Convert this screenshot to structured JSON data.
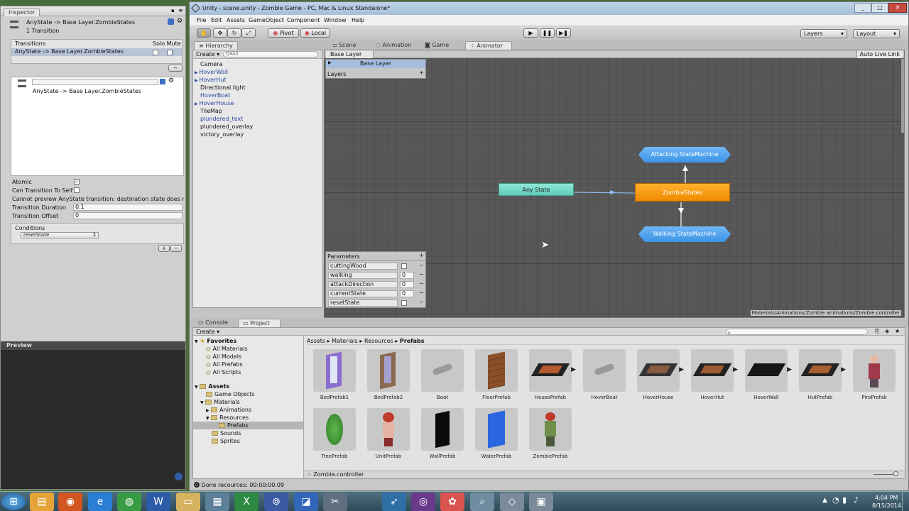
{
  "inspector": {
    "tab": "Inspector",
    "title": "AnyState -> Base Layer.ZombieStates",
    "subtitle": "1 Transition",
    "transitions_header": "Transitions",
    "solo_mute": "Solo Mute",
    "transition_row": "AnyState -> Base Layer.ZombieStates",
    "detail_name": "AnyState -> Base Layer.ZombieStates",
    "atomic": "Atomic",
    "can_self": "Can Transition To Self",
    "cannot_preview": "Cannot preview AnyState transition:  destination state does no",
    "duration_label": "Transition Duration",
    "duration_value": "0.1",
    "offset_label": "Transition Offset",
    "offset_value": "0",
    "conditions": "Conditions",
    "condition": "resetState",
    "preview": "Preview"
  },
  "window": {
    "title": "Unity - scene.unity - Zombie Game - PC, Mac & Linux Standalone*"
  },
  "menu": [
    "File",
    "Edit",
    "Assets",
    "GameObject",
    "Component",
    "Window",
    "Help"
  ],
  "toolbar": {
    "pivot": "Pivot",
    "local": "Local",
    "layers": "Layers",
    "layout": "Layout"
  },
  "tabs": {
    "hierarchy": "Hierarchy",
    "scene": "Scene",
    "animation": "Animation",
    "game": "Game",
    "animator": "Animator",
    "console": "Console",
    "project": "Project"
  },
  "hierarchy": {
    "create": "Create",
    "search": "Q▾All",
    "items": [
      "Camera",
      "HoverWall",
      "HoverHut",
      "Directional light",
      "HoverBoat",
      "HoverHouse",
      "TileMap",
      "plundered_text",
      "plundered_overlay",
      "victory_overlay"
    ]
  },
  "animator": {
    "breadcrumb": "Base Layer",
    "auto_live": "Auto Live Link",
    "layer": "Base Layer",
    "layers": "Layers",
    "parameters": "Parameters",
    "params": [
      {
        "name": "cuttingWood",
        "value": ""
      },
      {
        "name": "walking",
        "value": "0"
      },
      {
        "name": "attackDirection",
        "value": "0"
      },
      {
        "name": "currentState",
        "value": "0"
      },
      {
        "name": "resetState",
        "value": ""
      }
    ],
    "nodes": {
      "any": "Any State",
      "zombie": "ZombieStates",
      "attack": "Attacking StateMachine",
      "walk": "Walking StateMachine"
    },
    "path": "Materials/Animations/Zombie animations/Zombie.controller"
  },
  "project": {
    "create": "Create",
    "breadcrumb": [
      "Assets",
      "Materials",
      "Resources",
      "Prefabs"
    ],
    "favorites": "Favorites",
    "fav_items": [
      "All Materials",
      "All Models",
      "All Prefabs",
      "All Scripts"
    ],
    "assets": "Assets",
    "tree": [
      "Game Objects",
      "Materials",
      "Animations",
      "Resources",
      "Prefabs",
      "Sounds",
      "Sprites"
    ],
    "items": [
      "BedPrefab1",
      "BedPrefab2",
      "Boat",
      "FloorPrefab",
      "HousePrefab",
      "HoverBoat",
      "HoverHouse",
      "HoverHut",
      "HoverWall",
      "HutPrefab",
      "PiroPrefab",
      "TreePrefab",
      "UnitPrefab",
      "WallPrefab",
      "WaterPrefab",
      "ZombiePrefab"
    ],
    "selected": "Zombie.controller"
  },
  "status": "Done recources: 00:00:00.09",
  "clock": {
    "time": "4:04 PM",
    "date": "8/15/2014"
  }
}
